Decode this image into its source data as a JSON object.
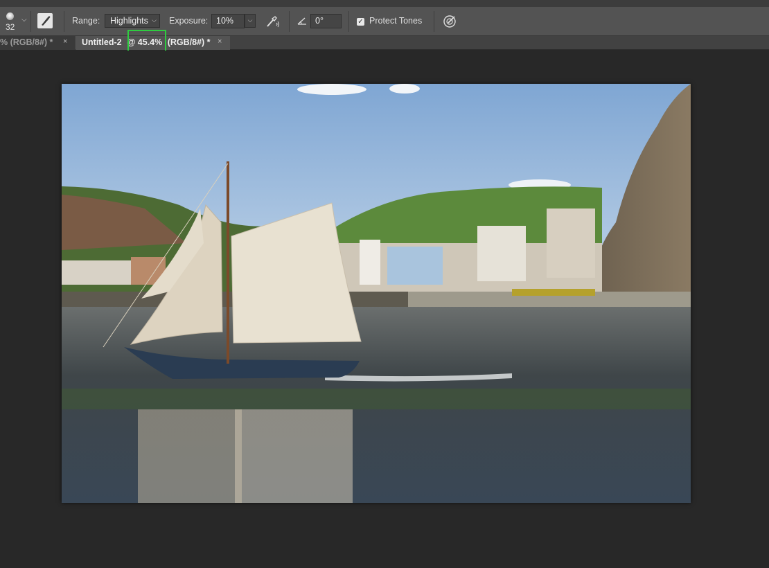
{
  "options_bar": {
    "brush_size": "32",
    "range_label": "Range:",
    "range_value": "Highlights",
    "exposure_label": "Exposure:",
    "exposure_value": "10%",
    "angle_value": "0°",
    "protect_tones_label": "Protect Tones",
    "protect_tones_checked": true
  },
  "tabs": [
    {
      "label": "% (RGB/8#) *",
      "active": false
    },
    {
      "title": "Untitled-2",
      "zoom": "@ 45.4%",
      "mode": "(RGB/8#) *",
      "active": true
    }
  ],
  "icons": {
    "brush_preset": "brush-dot-icon",
    "tool": "burn-dodge-brush-icon",
    "airbrush": "airbrush-icon",
    "angle": "angle-icon",
    "pressure": "pressure-icon",
    "close": "×",
    "chevron": "⌵"
  },
  "colors": {
    "highlight": "#2ecc40",
    "workspace": "#282828",
    "options_bar": "#535353"
  },
  "document": {
    "description_hidden": true
  }
}
